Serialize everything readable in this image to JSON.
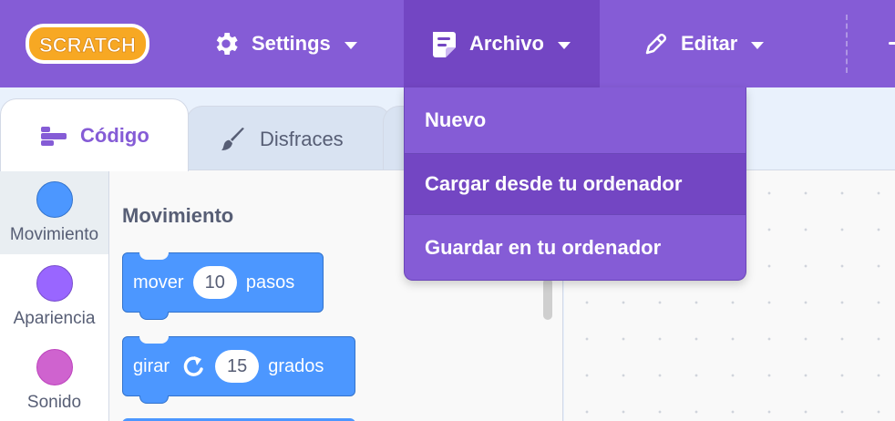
{
  "menubar": {
    "logo_text": "SCRATCH",
    "settings_label": "Settings",
    "file_label": "Archivo",
    "edit_label": "Editar",
    "background_color": "#855cd6"
  },
  "file_menu": {
    "items": [
      {
        "label": "Nuevo"
      },
      {
        "label": "Cargar desde tu ordenador"
      },
      {
        "label": "Guardar en tu ordenador"
      }
    ]
  },
  "tabs": [
    {
      "label": "Código",
      "icon": "code-icon",
      "active": true
    },
    {
      "label": "Disfraces",
      "icon": "paintbrush-icon",
      "active": false
    },
    {
      "label": "",
      "icon": "",
      "active": false
    }
  ],
  "categories": [
    {
      "label": "Movimiento",
      "color": "#4c97ff"
    },
    {
      "label": "Apariencia",
      "color": "#9966ff"
    },
    {
      "label": "Sonido",
      "color": "#cf63cf"
    }
  ],
  "palette": {
    "section_title": "Movimiento",
    "blocks": [
      {
        "before": "mover",
        "value": "10",
        "after": "pasos"
      },
      {
        "before": "girar",
        "value": "15",
        "after": "grados"
      }
    ]
  }
}
